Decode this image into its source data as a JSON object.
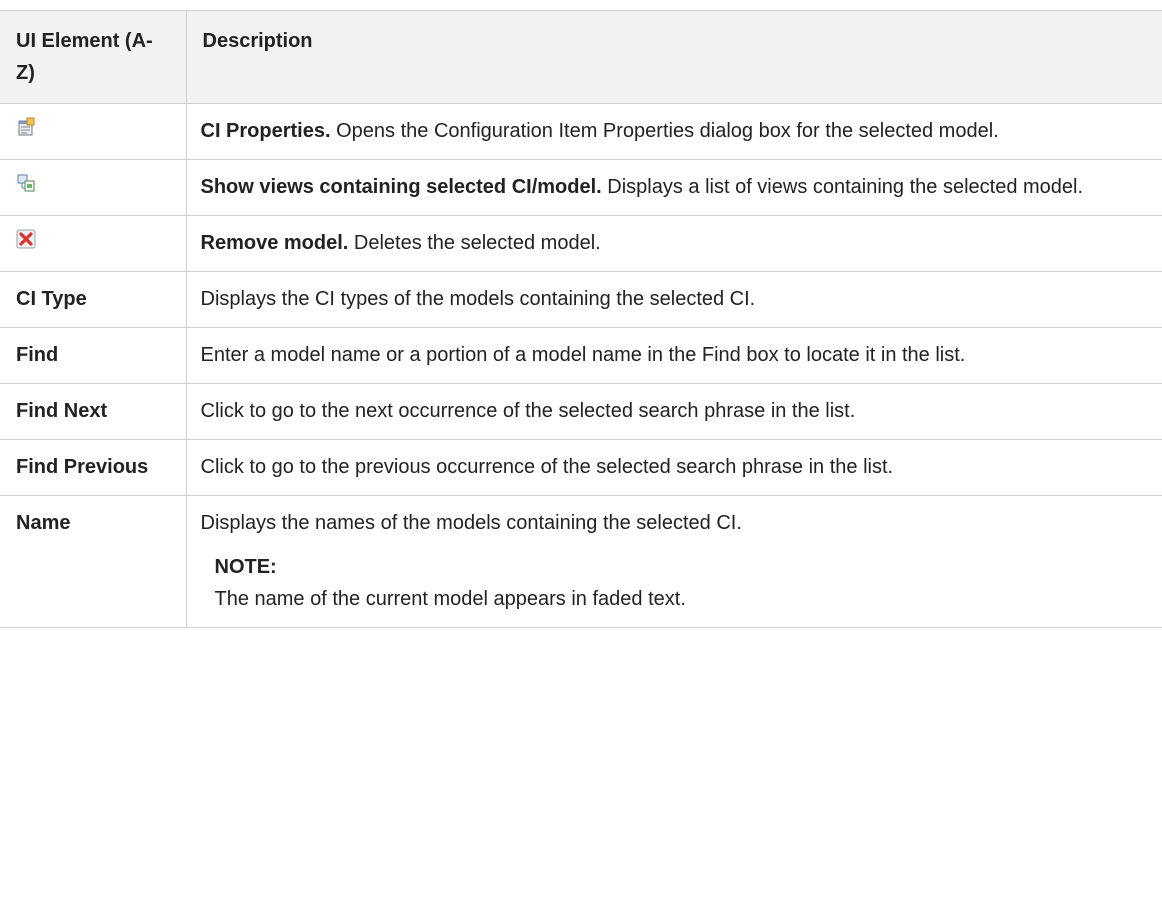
{
  "table": {
    "headers": [
      "UI Element (A-Z)",
      "Description"
    ],
    "rows": [
      {
        "icon": "properties-icon",
        "term": "CI Properties.",
        "text": " Opens the Configuration Item Properties dialog box for the selected model."
      },
      {
        "icon": "show-views-icon",
        "term": "Show views containing selected CI/model.",
        "text": " Displays a list of views containing the selected model."
      },
      {
        "icon": "remove-icon",
        "term": "Remove model.",
        "text": " Deletes the selected model."
      },
      {
        "element": "CI Type",
        "text": "Displays the CI types of the models containing the selected CI."
      },
      {
        "element": "Find",
        "text": "Enter a model name or a portion of a model name in the Find box to locate it in the list."
      },
      {
        "element": "Find Next",
        "text": "Click to go to the next occurrence of the selected search phrase in the list."
      },
      {
        "element": "Find Previous",
        "text": "Click to go to the previous occurrence of the selected search phrase in the list."
      },
      {
        "element": "Name",
        "text": "Displays the names of the models containing the selected CI.",
        "note_label": "NOTE:",
        "note_text": "The name of the current model appears in faded text."
      }
    ]
  }
}
